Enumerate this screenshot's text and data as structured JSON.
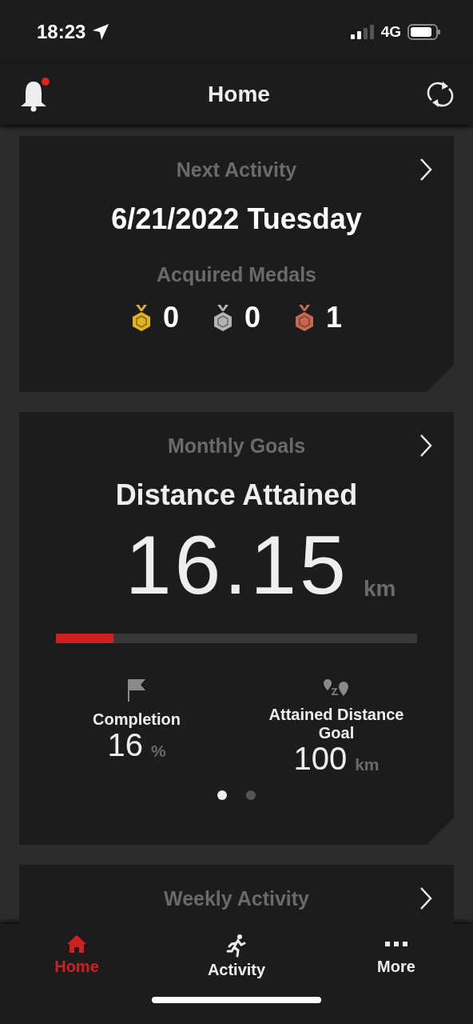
{
  "status_bar": {
    "time": "18:23",
    "network": "4G"
  },
  "header": {
    "title": "Home",
    "notification_badge": true
  },
  "next_activity": {
    "title": "Next Activity",
    "date": "6/21/2022 Tuesday",
    "medals_title": "Acquired Medals",
    "medals": [
      {
        "count": "0",
        "color": "#e2b320"
      },
      {
        "count": "0",
        "color": "#b4b4b4"
      },
      {
        "count": "1",
        "color": "#c8684e"
      }
    ]
  },
  "monthly_goals": {
    "title": "Monthly Goals",
    "subtitle": "Distance Attained",
    "distance": "16.15",
    "unit": "km",
    "level": 0.16,
    "completion_label": "Completion",
    "completion_value": "16",
    "completion_unit": "%",
    "goal_label": "Attained Distance Goal",
    "goal_value": "100",
    "goal_unit": "km",
    "pages": [
      {
        "selected": true
      },
      {
        "selected": false
      }
    ]
  },
  "weekly_activity": {
    "title": "Weekly Activity"
  },
  "tab_bar": [
    {
      "label": "Home",
      "kind": "home",
      "selected": true
    },
    {
      "label": "Activity",
      "kind": "activity",
      "selected": false
    },
    {
      "label": "More",
      "kind": "more",
      "selected": false
    }
  ]
}
